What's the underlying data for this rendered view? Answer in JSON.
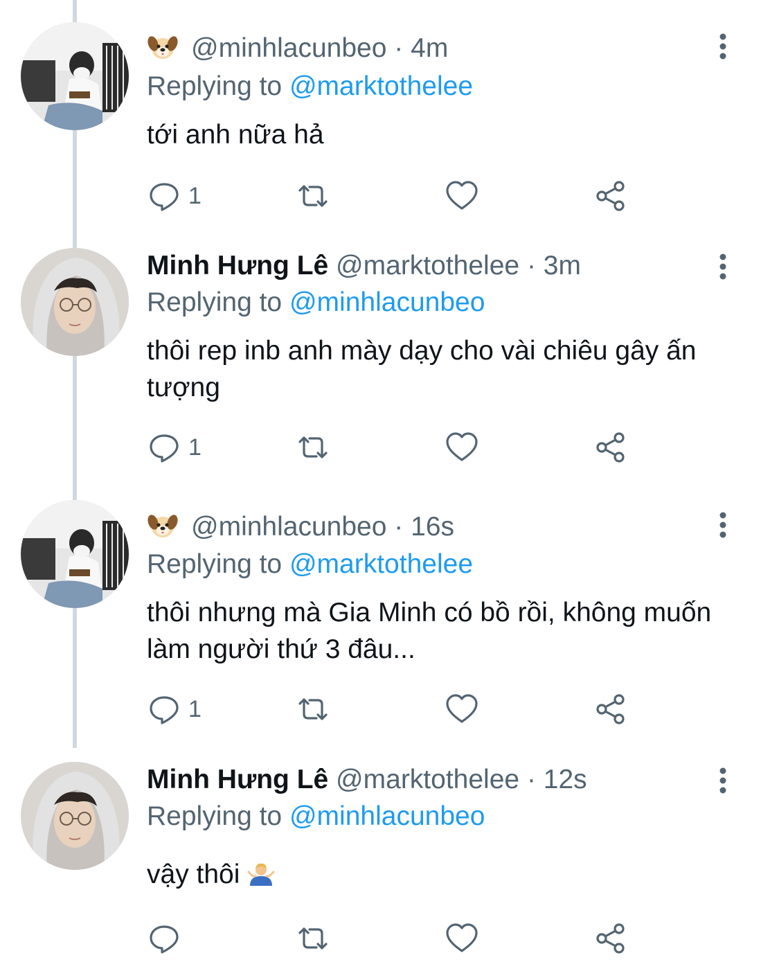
{
  "tweets": [
    {
      "display_name": "",
      "has_dog_emoji": true,
      "handle": "@minhlacunbeo",
      "separator": "·",
      "time": "4m",
      "replying_prefix": "Replying to",
      "replying_to": "@marktothelee",
      "text": "tới anh nữa hả",
      "reply_count": "1",
      "avatar": "user-piano"
    },
    {
      "display_name": "Minh Hưng Lê",
      "has_dog_emoji": false,
      "handle": "@marktothelee",
      "separator": "·",
      "time": "3m",
      "replying_prefix": "Replying to",
      "replying_to": "@minhlacunbeo",
      "text": "thôi rep inb anh mày dạy cho vài chiêu gây ấn tượng",
      "reply_count": "1",
      "avatar": "user-hoodie"
    },
    {
      "display_name": "",
      "has_dog_emoji": true,
      "handle": "@minhlacunbeo",
      "separator": "·",
      "time": "16s",
      "replying_prefix": "Replying to",
      "replying_to": "@marktothelee",
      "text": "thôi nhưng mà Gia Minh có bồ rồi, không muốn làm người thứ 3 đâu...",
      "reply_count": "1",
      "avatar": "user-piano"
    },
    {
      "display_name": "Minh Hưng Lê",
      "has_dog_emoji": false,
      "handle": "@marktothelee",
      "separator": "·",
      "time": "12s",
      "replying_prefix": "Replying to",
      "replying_to": "@minhlacunbeo",
      "text": "vậy thôi",
      "has_shrug_emoji": true,
      "reply_count": "",
      "avatar": "user-hoodie"
    }
  ],
  "icons": {
    "reply": "reply-icon",
    "retweet": "retweet-icon",
    "like": "heart-icon",
    "share": "share-icon",
    "more": "more-vertical-icon"
  },
  "colors": {
    "link": "#1d9bf0",
    "secondary": "#536471",
    "thread_line": "#cfd9de",
    "text": "#0f1419"
  }
}
